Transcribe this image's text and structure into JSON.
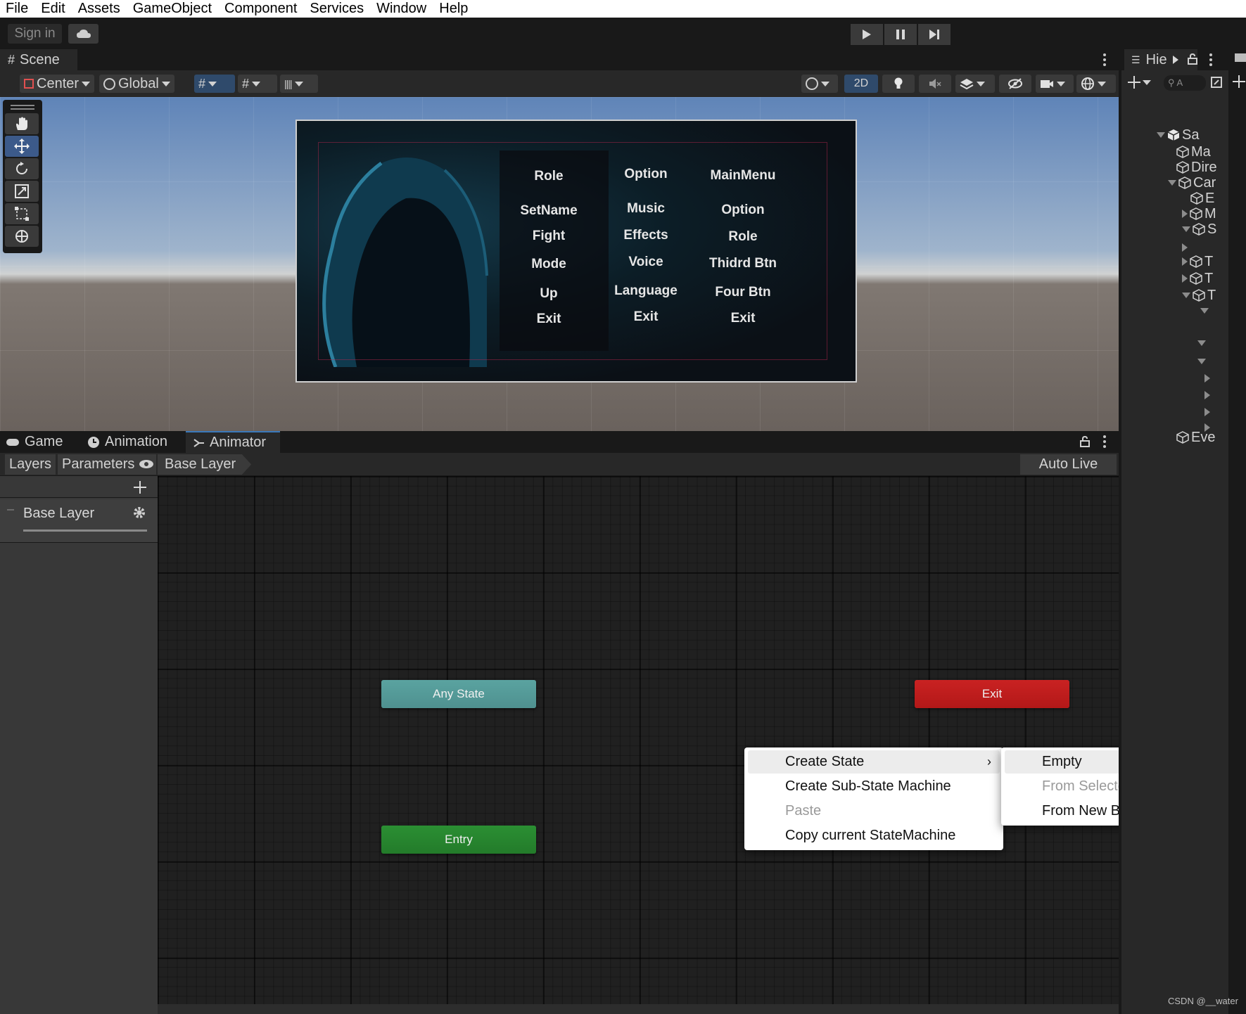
{
  "menu": [
    "File",
    "Edit",
    "Assets",
    "GameObject",
    "Component",
    "Services",
    "Window",
    "Help"
  ],
  "toolbar": {
    "signin": "Sign in"
  },
  "scene": {
    "tab": "Scene",
    "pivot": "Center",
    "space": "Global",
    "mode2d": "2D",
    "game_columns": [
      [
        "Role",
        "SetName",
        "Fight",
        "Mode",
        "Up",
        "Exit"
      ],
      [
        "Option",
        "Music",
        "Effects",
        "Voice",
        "Language",
        "Exit"
      ],
      [
        "MainMenu",
        "Option",
        "Role",
        "Thidrd Btn",
        "Four Btn",
        "Exit"
      ]
    ]
  },
  "bottom_tabs": [
    "Game",
    "Animation",
    "Animator"
  ],
  "animator": {
    "layers_tab": "Layers",
    "parameters_tab": "Parameters",
    "breadcrumb": "Base Layer",
    "auto_live_link": "Auto Live Link",
    "layer_name": "Base Layer",
    "nodes": {
      "any_state": "Any State",
      "exit": "Exit",
      "entry": "Entry"
    },
    "node_colors": {
      "any_state": "#4f9190",
      "exit": "#b31818",
      "entry": "#237b2a"
    }
  },
  "context_menu": {
    "items": [
      {
        "label": "Create State",
        "disabled": false,
        "highlight": true,
        "submenu": true
      },
      {
        "label": "Create Sub-State Machine",
        "disabled": false
      },
      {
        "label": "Paste",
        "disabled": true
      },
      {
        "label": "Copy current StateMachine",
        "disabled": false
      }
    ],
    "submenu": [
      {
        "label": "Empty",
        "disabled": false,
        "highlight": true
      },
      {
        "label": "From Selected Clip",
        "disabled": true
      },
      {
        "label": "From New Blend Tree",
        "disabled": false
      }
    ]
  },
  "hierarchy": {
    "tab": "Hie",
    "search": "A",
    "items": [
      "Sa",
      "Ma",
      "Dire",
      "Car",
      "E",
      "M",
      "S",
      "T",
      "T",
      "T",
      "Eve"
    ]
  },
  "watermark": "CSDN @__water"
}
